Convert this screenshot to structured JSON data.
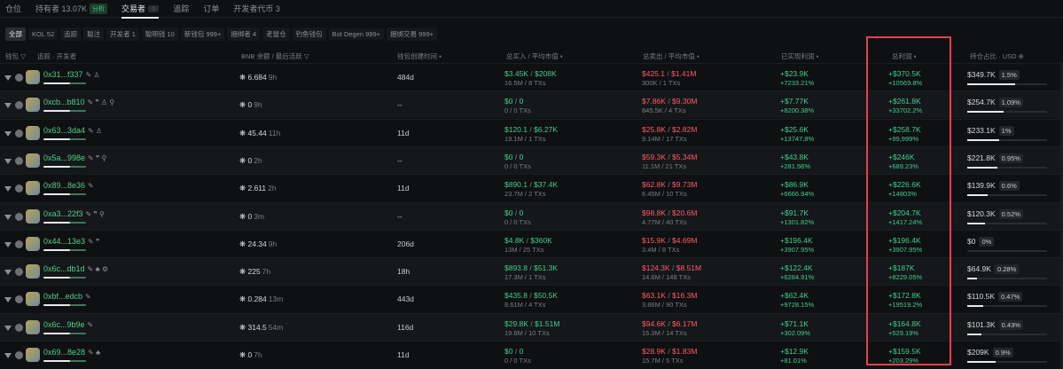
{
  "nav": {
    "tabs": [
      {
        "label": "仓位"
      },
      {
        "label": "持有者 13.07K",
        "badge": "分析"
      },
      {
        "label": "交易者",
        "badge": "☆"
      },
      {
        "label": "追踪"
      },
      {
        "label": "订单"
      },
      {
        "label": "开发者代币 3"
      }
    ]
  },
  "filters": [
    "全部",
    "KOL 52",
    "追踪",
    "聪注",
    "开发者 1",
    "聪明钱 10",
    "新钱包 999+",
    "捆绑者 4",
    "老鼠仓",
    "钓鱼钱包",
    "Bot Degen 999+",
    "捆绑交易 999+"
  ],
  "headers": {
    "wallet": "钱包 ▽",
    "follow": "追踪 · 开发者",
    "balance": "BNB 余额 / 最后活跃 ▽",
    "created": "钱包创建时间 ▪",
    "bought": "总买入 / 平均市值 ▪",
    "sold": "总卖出 / 平均市值 ▪",
    "realized": "已实现利润 ▪",
    "total": "总利润 ▪",
    "holding": "持仓占比 · USD ⊕"
  },
  "rows": [
    {
      "addr": "0x31...f337",
      "icons": "✎ ♙",
      "bal": "6.684",
      "t": "9h",
      "age": "484d",
      "buy": "$3.45K",
      "buyMc": "$208K",
      "buySub": "16.5M / 8 TXs",
      "sell": "$425.1",
      "sellMc": "$1.41M",
      "sellSub": "300K / 1 TXs",
      "real": "+$23.9K",
      "realPct": "+7233.21%",
      "tot": "+$370.5K",
      "totPct": "+10569.8%",
      "hold": "$349.7K",
      "holdPct": "1.5%",
      "holdFill": 0.6
    },
    {
      "addr": "0xcb...b810",
      "icons": "✎ ❞ ♙ ⚲",
      "bal": "0",
      "t": "9h",
      "age": "--",
      "buy": "$0",
      "buyMc": "0",
      "buySub": "0 / 0 TXs",
      "sell": "$7.86K",
      "sellMc": "$9.30M",
      "sellSub": "845.5K / 4 TXs",
      "real": "+$7.77K",
      "realPct": "+8200.38%",
      "tot": "+$261.8K",
      "totPct": "+33702.2%",
      "hold": "$254.7K",
      "holdPct": "1.09%",
      "holdFill": 0.45
    },
    {
      "addr": "0x63...3da4",
      "icons": "✎ ♙",
      "bal": "45.44",
      "t": "11h",
      "age": "11d",
      "buy": "$120.1",
      "buyMc": "$6.27K",
      "buySub": "19.1M / 1 TXs",
      "sell": "$25.8K",
      "sellMc": "$2.82M",
      "sellSub": "9.14M / 17 TXs",
      "real": "+$25.6K",
      "realPct": "+13747.8%",
      "tot": "+$258.7K",
      "totPct": "+99,999%",
      "hold": "$233.1K",
      "holdPct": "1%",
      "holdFill": 0.4
    },
    {
      "addr": "0x5a...998e",
      "icons": "✎ ❞ ⚲",
      "bal": "0",
      "t": "2h",
      "age": "--",
      "buy": "$0",
      "buyMc": "0",
      "buySub": "0 / 0 TXs",
      "sell": "$59.3K",
      "sellMc": "$5.34M",
      "sellSub": "11.1M / 21 TXs",
      "real": "+$43.8K",
      "realPct": "+281.56%",
      "tot": "+$246K",
      "totPct": "+689.23%",
      "hold": "$221.8K",
      "holdPct": "0.95%",
      "holdFill": 0.38
    },
    {
      "addr": "0x89...8e36",
      "icons": "✎",
      "bal": "2.611",
      "t": "2h",
      "age": "11d",
      "buy": "$890.1",
      "buyMc": "$37.4K",
      "buySub": "23.7M / 2 TXs",
      "sell": "$62.8K",
      "sellMc": "$9.73M",
      "sellSub": "6.45M / 10 TXs",
      "real": "+$86.9K",
      "realPct": "+6666.94%",
      "tot": "+$226.6K",
      "totPct": "+14803%",
      "hold": "$139.9K",
      "holdPct": "0.6%",
      "holdFill": 0.25
    },
    {
      "addr": "0xa3...22f3",
      "icons": "✎ ❞ ⚲",
      "bal": "0",
      "t": "3m",
      "age": "--",
      "buy": "$0",
      "buyMc": "0",
      "buySub": "0 / 0 TXs",
      "sell": "$98.8K",
      "sellMc": "$20.6M",
      "sellSub": "4.77M / 40 TXs",
      "real": "+$91.7K",
      "realPct": "+1301.82%",
      "tot": "+$204.7K",
      "totPct": "+1417.24%",
      "hold": "$120.3K",
      "holdPct": "0.52%",
      "holdFill": 0.22
    },
    {
      "addr": "0x44...13e3",
      "icons": "✎ ❞",
      "bal": "24.34",
      "t": "9h",
      "age": "206d",
      "buy": "$4.8K",
      "buyMc": "$360K",
      "buySub": "13M / 25 TXs",
      "sell": "$15.9K",
      "sellMc": "$4.69M",
      "sellSub": "3.4M / 8 TXs",
      "real": "+$196.4K",
      "realPct": "+3907.95%",
      "tot": "+$196.4K",
      "totPct": "+3907.95%",
      "hold": "$0",
      "holdPct": "0%",
      "holdFill": 0.0
    },
    {
      "addr": "0x6c...db1d",
      "icons": "✎ ♣ ⚙",
      "bal": "225",
      "t": "7h",
      "age": "18h",
      "buy": "$893.8",
      "buyMc": "$51.3K",
      "buySub": "17.3M / 1 TXs",
      "sell": "$124.3K",
      "sellMc": "$8.51M",
      "sellSub": "14.6M / 148 TXs",
      "real": "+$122.4K",
      "realPct": "+6284.91%",
      "tot": "+$187K",
      "totPct": "+8229.05%",
      "hold": "$64.9K",
      "holdPct": "0.28%",
      "holdFill": 0.12
    },
    {
      "addr": "0xbf...edcb",
      "icons": "✎",
      "bal": "0.284",
      "t": "13m",
      "age": "443d",
      "buy": "$435.8",
      "buyMc": "$50.5K",
      "buySub": "8.61M / 4 TXs",
      "sell": "$63.1K",
      "sellMc": "$16.3M",
      "sellSub": "3.86M / 90 TXs",
      "real": "+$62.4K",
      "realPct": "+9728.15%",
      "tot": "+$172.8K",
      "totPct": "+19519.2%",
      "hold": "$110.5K",
      "holdPct": "0.47%",
      "holdFill": 0.2
    },
    {
      "addr": "0x6c...9b9e",
      "icons": "✎",
      "bal": "314.5",
      "t": "54m",
      "age": "116d",
      "buy": "$29.8K",
      "buyMc": "$1.51M",
      "buySub": "19.6M / 10 TXs",
      "sell": "$94.6K",
      "sellMc": "$6.17M",
      "sellSub": "15.3M / 14 TXs",
      "real": "+$71.1K",
      "realPct": "+302.09%",
      "tot": "+$164.8K",
      "totPct": "+529.19%",
      "hold": "$101.3K",
      "holdPct": "0.43%",
      "holdFill": 0.18
    },
    {
      "addr": "0x69...8e28",
      "icons": "✎ ♣",
      "bal": "0",
      "t": "7h",
      "age": "11d",
      "buy": "$0",
      "buyMc": "0",
      "buySub": "0 / 0 TXs",
      "sell": "$28.9K",
      "sellMc": "$1.83M",
      "sellSub": "15.7M / 5 TXs",
      "real": "+$12.9K",
      "realPct": "+81.01%",
      "tot": "+$159.5K",
      "totPct": "+203.29%",
      "hold": "$209K",
      "holdPct": "0.9%",
      "holdFill": 0.36
    }
  ]
}
